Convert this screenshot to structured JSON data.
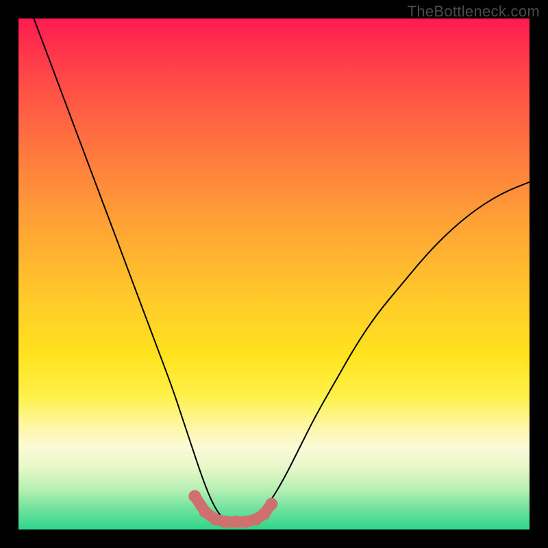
{
  "attribution": "TheBottleneck.com",
  "chart_data": {
    "type": "line",
    "title": "",
    "xlabel": "",
    "ylabel": "",
    "xlim": [
      0,
      100
    ],
    "ylim": [
      0,
      100
    ],
    "grid": false,
    "legend": false,
    "background_gradient": {
      "orientation": "vertical",
      "stops": [
        {
          "pos": 0.0,
          "color": "#ff1a51"
        },
        {
          "pos": 0.3,
          "color": "#ff843c"
        },
        {
          "pos": 0.66,
          "color": "#ffe31e"
        },
        {
          "pos": 0.84,
          "color": "#fbfad8"
        },
        {
          "pos": 1.0,
          "color": "#2fd58a"
        }
      ]
    },
    "series": [
      {
        "name": "bottleneck-curve",
        "stroke": "#000000",
        "stroke_width": 2,
        "x": [
          3,
          6,
          9,
          12,
          15,
          18,
          21,
          24,
          27,
          30,
          32,
          34,
          36,
          38,
          40,
          42,
          44,
          46,
          49,
          52,
          55,
          58,
          62,
          66,
          70,
          75,
          80,
          85,
          90,
          95,
          100
        ],
        "y": [
          100,
          92,
          84,
          76,
          68,
          60,
          52,
          44,
          36,
          28,
          22,
          16,
          10,
          5,
          2,
          1,
          1,
          2,
          5,
          10,
          16,
          22,
          29,
          36,
          42,
          48,
          54,
          59,
          63,
          66,
          68
        ]
      },
      {
        "name": "bottom-markers",
        "type": "scatter",
        "marker_color": "#cf6f6e",
        "marker_radius": 9,
        "x": [
          34.5,
          36.5,
          38.5,
          40.5,
          42.5,
          44.5,
          46.5,
          48.0,
          49.5
        ],
        "y": [
          6.5,
          3.5,
          2.0,
          1.5,
          1.5,
          1.5,
          2.0,
          3.0,
          5.0
        ]
      }
    ],
    "annotations": []
  }
}
